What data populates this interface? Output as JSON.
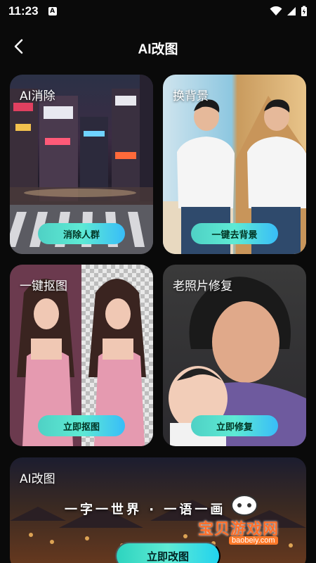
{
  "status": {
    "time": "11:23",
    "notif": "A"
  },
  "nav": {
    "title": "AI改图"
  },
  "cards": [
    {
      "title": "AI消除",
      "button": "消除人群"
    },
    {
      "title": "换背景",
      "button": "一键去背景"
    },
    {
      "title": "一键抠图",
      "button": "立即抠图"
    },
    {
      "title": "老照片修复",
      "button": "立即修复"
    },
    {
      "title": "AI改图",
      "slogan": "一字一世界 · 一语一画",
      "button": "立即改图"
    }
  ],
  "watermark": {
    "text": "宝贝游戏网",
    "url": "baobeiy.com"
  }
}
